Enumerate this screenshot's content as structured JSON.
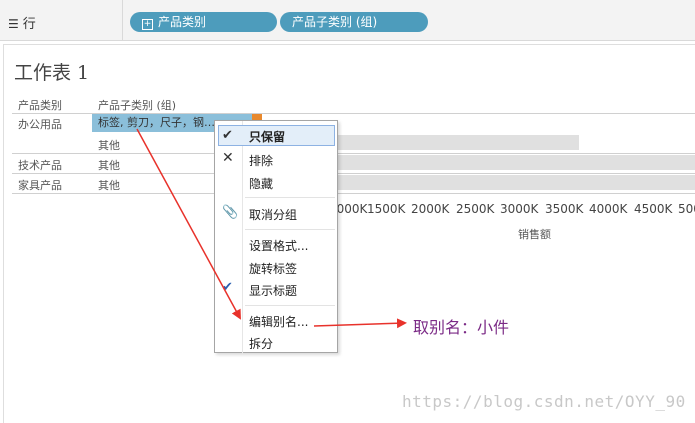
{
  "toolbar": {
    "rows_label": "行",
    "pill1": "产品类别",
    "pill2": "产品子类别 (组)"
  },
  "sheet": {
    "title": "工作表 1",
    "col_headers": [
      "产品类别",
      "产品子类别 (组)"
    ],
    "rows": [
      {
        "category": "办公用品",
        "sub": "标签, 剪刀，尺子，钢…",
        "selected": true
      },
      {
        "category": "",
        "sub": "其他",
        "selected": false
      },
      {
        "category": "技术产品",
        "sub": "其他",
        "selected": false
      },
      {
        "category": "家具产品",
        "sub": "其他",
        "selected": false
      }
    ],
    "axis_ticks": [
      "1000K",
      "1500K",
      "2000K",
      "2500K",
      "3000K",
      "3500K",
      "4000K",
      "4500K",
      "500"
    ],
    "axis_title": "销售额"
  },
  "context_menu": {
    "items": [
      "只保留",
      "排除",
      "隐藏",
      "取消分组",
      "设置格式...",
      "旋转标签",
      "显示标题",
      "编辑别名...",
      "拆分"
    ]
  },
  "annotation": "取别名：小件",
  "watermark": "https://blog.csdn.net/OYY_90",
  "colors": {
    "pill": "#4d9cbc",
    "selection": "#8bbfda",
    "annotation": "#7b2a86",
    "arrow": "#e8322b"
  }
}
